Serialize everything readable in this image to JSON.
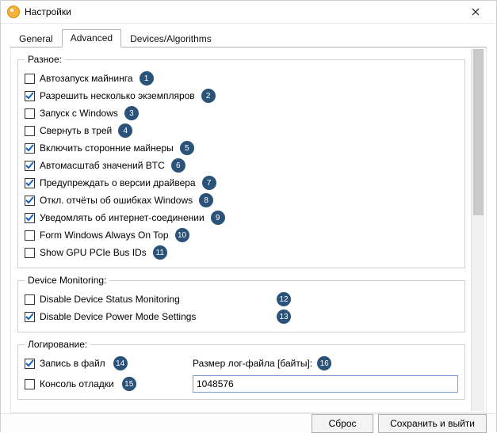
{
  "window": {
    "title": "Настройки"
  },
  "tabs": {
    "general": "General",
    "advanced": "Advanced",
    "devices": "Devices/Algorithms",
    "active": "advanced"
  },
  "groups": {
    "misc": {
      "legend": "Разное:",
      "items": [
        {
          "label": "Автозапуск майнинга",
          "checked": false,
          "badge": "1"
        },
        {
          "label": "Разрешить несколько экземпляров",
          "checked": true,
          "badge": "2"
        },
        {
          "label": "Запуск с Windows",
          "checked": false,
          "badge": "3"
        },
        {
          "label": "Свернуть в трей",
          "checked": false,
          "badge": "4"
        },
        {
          "label": "Включить сторонние майнеры",
          "checked": true,
          "badge": "5"
        },
        {
          "label": "Автомасштаб значений BTC",
          "checked": true,
          "badge": "6"
        },
        {
          "label": "Предупреждать о версии драйвера",
          "checked": true,
          "badge": "7"
        },
        {
          "label": "Откл. отчёты об ошибках Windows",
          "checked": true,
          "badge": "8"
        },
        {
          "label": "Уведомлять об интернет-соединении",
          "checked": true,
          "badge": "9"
        },
        {
          "label": "Form Windows Always On Top",
          "checked": false,
          "badge": "10"
        },
        {
          "label": "Show GPU PCIe Bus IDs",
          "checked": false,
          "badge": "11"
        }
      ]
    },
    "devmon": {
      "legend": "Device Monitoring:",
      "items": [
        {
          "label": "Disable Device Status Monitoring",
          "checked": false,
          "badge": "12"
        },
        {
          "label": "Disable Device Power Mode Settings",
          "checked": true,
          "badge": "13"
        }
      ]
    },
    "logging": {
      "legend": "Логирование:",
      "write_file": {
        "label": "Запись в файл",
        "checked": true,
        "badge": "14"
      },
      "debug_console": {
        "label": "Консоль отладки",
        "checked": false,
        "badge": "15"
      },
      "size_label": "Размер лог-файла [байты]:",
      "size_badge": "16",
      "size_value": "1048576"
    }
  },
  "footer": {
    "reset": "Сброс",
    "save_exit": "Сохранить и выйти"
  }
}
